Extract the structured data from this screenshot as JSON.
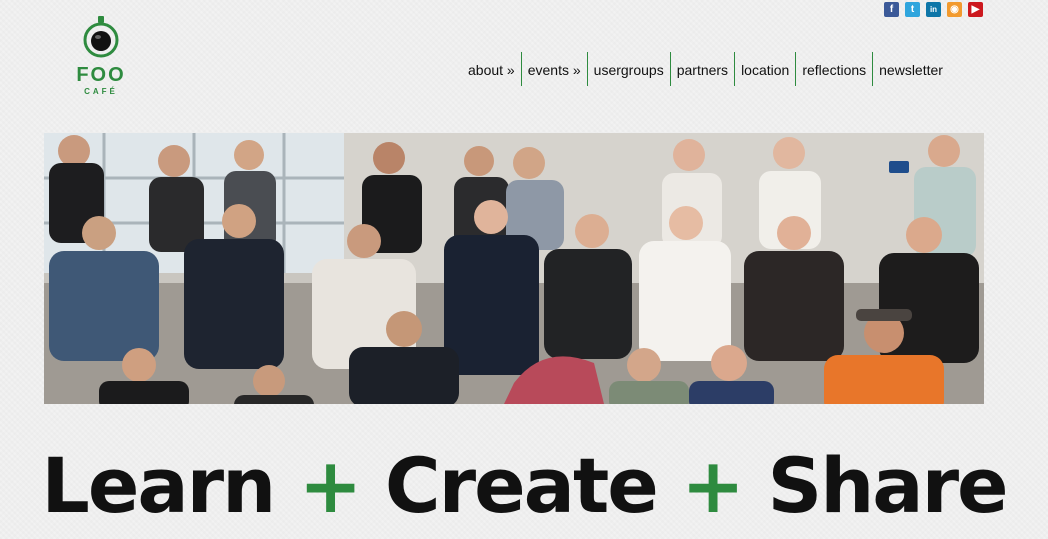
{
  "brand": {
    "name": "FOO",
    "sub": "CAFÉ",
    "green": "#2e8b3f"
  },
  "social": [
    {
      "name": "facebook",
      "glyph": "f"
    },
    {
      "name": "twitter",
      "glyph": "t"
    },
    {
      "name": "linkedin",
      "glyph": "in"
    },
    {
      "name": "rss",
      "glyph": "◉"
    },
    {
      "name": "youtube",
      "glyph": "▶"
    }
  ],
  "nav": [
    {
      "label": "about »"
    },
    {
      "label": "events »"
    },
    {
      "label": "usergroups"
    },
    {
      "label": "partners"
    },
    {
      "label": "location"
    },
    {
      "label": "reflections"
    },
    {
      "label": "newsletter"
    }
  ],
  "tagline": {
    "w1": "Learn",
    "plus1": "+",
    "w2": "Create",
    "plus2": "+",
    "w3": "Share"
  }
}
